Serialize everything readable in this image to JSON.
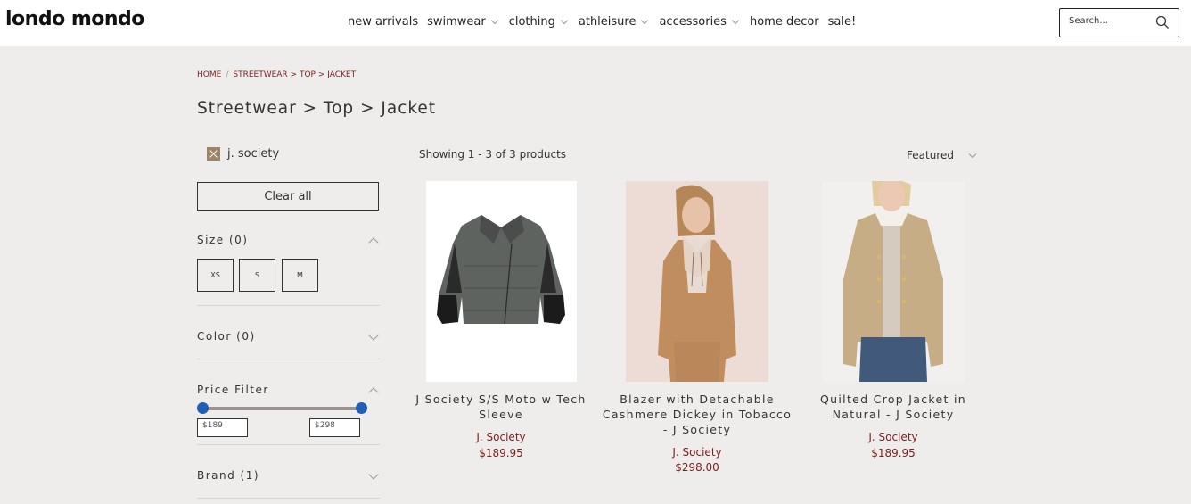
{
  "header": {
    "logo": "londo mondo",
    "nav": [
      {
        "label": "new arrivals",
        "dropdown": false
      },
      {
        "label": "swimwear",
        "dropdown": true
      },
      {
        "label": "clothing",
        "dropdown": true
      },
      {
        "label": "athleisure",
        "dropdown": true
      },
      {
        "label": "accessories",
        "dropdown": true
      },
      {
        "label": "home decor",
        "dropdown": false
      },
      {
        "label": "sale!",
        "dropdown": false
      }
    ],
    "search_placeholder": "Search..."
  },
  "breadcrumb": {
    "home": "HOME",
    "separator": "/",
    "current": "STREETWEAR > TOP > JACKET"
  },
  "page_title": "Streetwear > Top > Jacket",
  "sidebar": {
    "active_filter": "j. society",
    "clear_all": "Clear all",
    "size": {
      "heading": "Size (0)",
      "options": [
        "XS",
        "S",
        "M"
      ]
    },
    "color": {
      "heading": "Color (0)"
    },
    "price": {
      "heading": "Price Filter",
      "min": "$189",
      "max": "$298"
    },
    "brand": {
      "heading": "Brand (1)"
    }
  },
  "results": {
    "count_text": "Showing 1 - 3 of 3 products",
    "sort_label": "Featured"
  },
  "products": [
    {
      "title": "J Society S/S Moto w Tech Sleeve",
      "brand": "J. Society",
      "price": "$189.95"
    },
    {
      "title": "Blazer with Detachable Cashmere Dickey in Tobacco - J Society",
      "brand": "J. Society",
      "price": "$298.00"
    },
    {
      "title": "Quilted Crop Jacket in Natural - J Society",
      "brand": "J. Society",
      "price": "$189.95"
    }
  ],
  "colors": {
    "accent": "#7a1f1f",
    "slider_handle": "#1f5fb8",
    "filter_chip": "#9b8468",
    "background": "#eeedec"
  }
}
